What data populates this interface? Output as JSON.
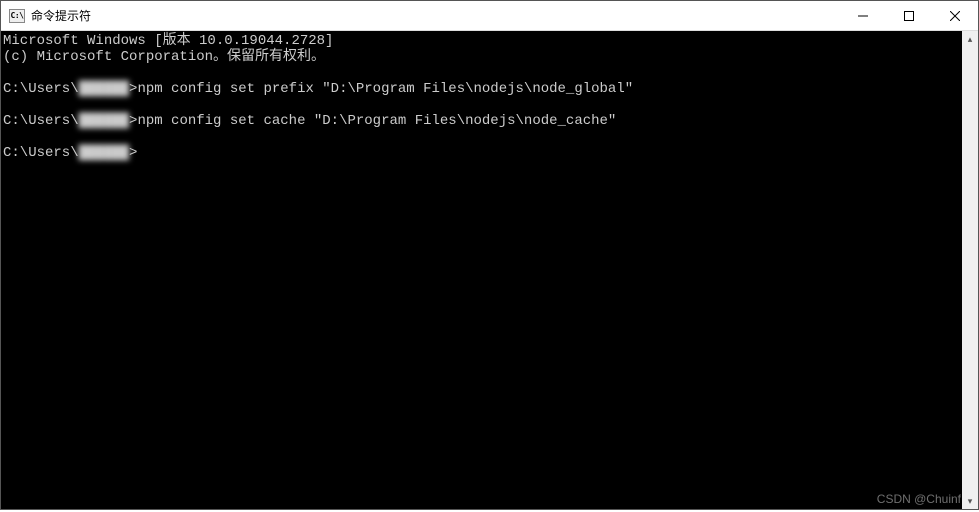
{
  "titlebar": {
    "icon_label": "C:\\",
    "title": "命令提示符"
  },
  "terminal": {
    "line1": "Microsoft Windows [版本 10.0.19044.2728]",
    "line2": "(c) Microsoft Corporation。保留所有权利。",
    "blank1": "",
    "prompt1_prefix": "C:\\Users\\",
    "prompt1_user_obscured": "██████",
    "prompt1_cmd": ">npm config set prefix \"D:\\Program Files\\nodejs\\node_global\"",
    "blank2": "",
    "prompt2_prefix": "C:\\Users\\",
    "prompt2_user_obscured": "██████",
    "prompt2_cmd": ">npm config set cache \"D:\\Program Files\\nodejs\\node_cache\"",
    "blank3": "",
    "prompt3_prefix": "C:\\Users\\",
    "prompt3_user_obscured": "██████",
    "prompt3_tail": ">"
  },
  "watermark": "CSDN @Chuinf"
}
